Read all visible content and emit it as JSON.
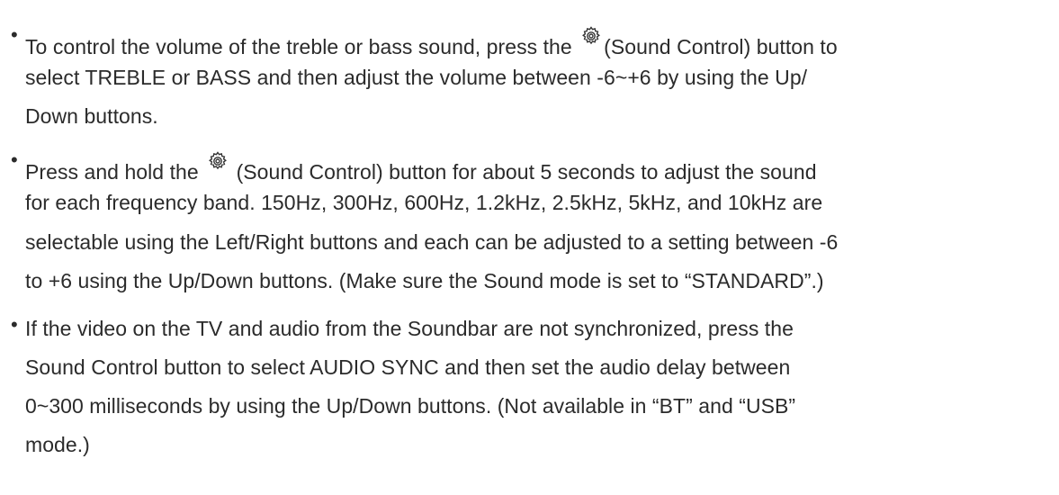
{
  "icons": {
    "sound_control": "gear-icon"
  },
  "bullets": [
    {
      "marker": "•",
      "lines": [
        {
          "before": "To control the volume of the treble or bass sound, press the ",
          "after": "(Sound Control) button to"
        },
        {
          "text": "select TREBLE or BASS and then adjust the volume between -6~+6 by using the Up/"
        },
        {
          "text": "Down buttons."
        }
      ]
    },
    {
      "marker": "•",
      "lines": [
        {
          "before": "Press and hold the ",
          "after": " (Sound Control) button for about 5 seconds to adjust the sound"
        },
        {
          "text": "for each frequency band. 150Hz, 300Hz, 600Hz, 1.2kHz, 2.5kHz, 5kHz, and 10kHz are"
        },
        {
          "text": "selectable using the Left/Right buttons and each can be adjusted to a setting between -6"
        },
        {
          "text": "to +6 using the Up/Down buttons. (Make sure the Sound mode is set to “STANDARD”.)"
        }
      ]
    },
    {
      "marker": "•",
      "lines": [
        {
          "text": "If the video on the TV and audio from the Soundbar are not synchronized, press the"
        },
        {
          "text": "Sound Control button to select AUDIO SYNC and then set the audio delay between"
        },
        {
          "text": "0~300 milliseconds by using the Up/Down buttons. (Not available in “BT” and “USB”"
        },
        {
          "text": "mode.)"
        }
      ]
    }
  ]
}
